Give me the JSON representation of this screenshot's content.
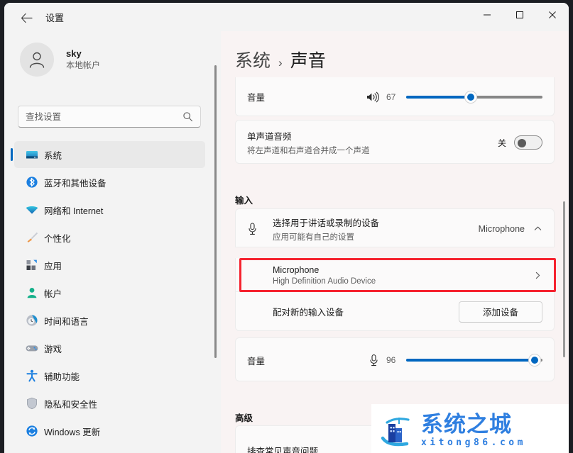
{
  "window": {
    "title": "设置",
    "back_icon": "arrow-left-icon",
    "controls": {
      "minimize": "—",
      "maximize": "□",
      "close": "✕"
    }
  },
  "sidebar": {
    "account": {
      "name": "sky",
      "type": "本地帐户",
      "avatar_icon": "person-icon"
    },
    "search": {
      "placeholder": "查找设置",
      "icon": "search-icon",
      "value": ""
    },
    "items": [
      {
        "label": "系统",
        "icon": "monitor-icon",
        "active": true
      },
      {
        "label": "蓝牙和其他设备",
        "icon": "bluetooth-icon",
        "active": false
      },
      {
        "label": "网络和 Internet",
        "icon": "wifi-icon",
        "active": false
      },
      {
        "label": "个性化",
        "icon": "paintbrush-icon",
        "active": false
      },
      {
        "label": "应用",
        "icon": "apps-icon",
        "active": false
      },
      {
        "label": "帐户",
        "icon": "account-icon",
        "active": false
      },
      {
        "label": "时间和语言",
        "icon": "clock-icon",
        "active": false
      },
      {
        "label": "游戏",
        "icon": "gamepad-icon",
        "active": false
      },
      {
        "label": "辅助功能",
        "icon": "accessibility-icon",
        "active": false
      },
      {
        "label": "隐私和安全性",
        "icon": "shield-icon",
        "active": false
      },
      {
        "label": "Windows 更新",
        "icon": "update-icon",
        "active": false
      }
    ]
  },
  "main": {
    "breadcrumb": {
      "root": "系统",
      "separator": "›",
      "leaf": "声音"
    },
    "output_volume": {
      "label": "音量",
      "icon": "speaker-icon",
      "value": "67",
      "percent": 67
    },
    "mono_audio": {
      "title": "单声道音频",
      "subtitle": "将左声道和右声道合并成一个声道",
      "state": "关",
      "on": false
    },
    "input_section": {
      "heading": "输入",
      "device_chooser": {
        "title": "选择用于讲话或录制的设备",
        "subtitle": "应用可能有自己的设置",
        "icon": "microphone-icon",
        "selected": "Microphone",
        "chevron": "chevron-up-icon",
        "expanded": true
      },
      "selected_device": {
        "title": "Microphone",
        "subtitle": "High Definition Audio Device",
        "chevron": "chevron-right-icon",
        "highlighted": true,
        "highlight_color": "#f5232f"
      },
      "pair_device": {
        "label": "配对新的输入设备",
        "button": "添加设备"
      },
      "input_volume": {
        "label": "音量",
        "icon": "microphone-icon",
        "value": "96",
        "percent": 96
      }
    },
    "advanced_section": {
      "heading": "高级",
      "first_item": "排查常见声音问题"
    }
  },
  "watermark": {
    "brand_cn": "系统之城",
    "url": "xitong86.com",
    "color": "#2f7fe0",
    "logo_icon": "building-wave-logo-icon"
  },
  "colors": {
    "accent": "#0067c0",
    "window_bg": "#f3f3f3",
    "card_bg": "#fbfafa",
    "main_bg": "#f9f3f3",
    "highlight": "#f5232f"
  }
}
